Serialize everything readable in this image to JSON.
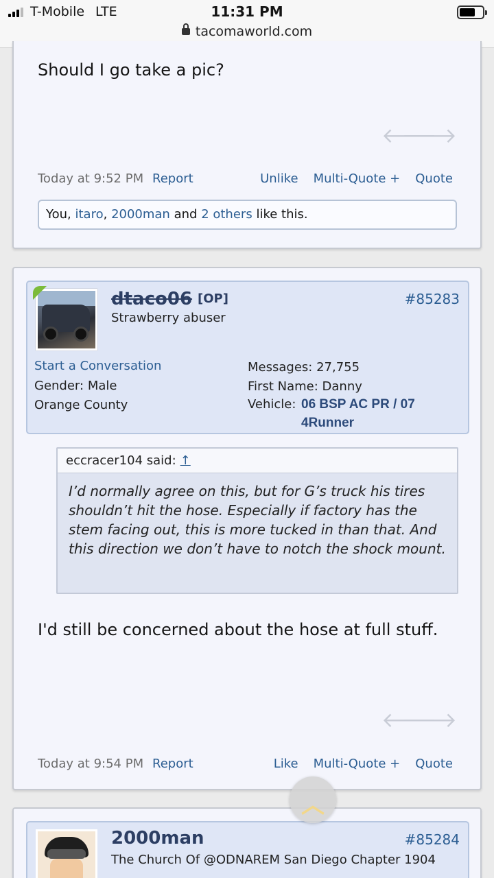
{
  "status_bar": {
    "carrier": "T-Mobile",
    "network": "LTE",
    "time": "11:31 PM",
    "url": "tacomaworld.com"
  },
  "post1": {
    "message": "Should I go take a pic?",
    "timestamp": "Today at 9:52 PM",
    "report": "Report",
    "like_action": "Unlike",
    "multi_quote": "Multi-Quote +",
    "quote": "Quote",
    "likes": {
      "you": "You,",
      "user1": "itaro",
      "sep": ",",
      "user2": "2000man",
      "and": "and",
      "others": "2 others",
      "tail": "like this."
    }
  },
  "post2": {
    "username": "dtaco06",
    "op_tag": "[OP]",
    "user_title": "Strawberry abuser",
    "post_number": "#85283",
    "start_conversation": "Start a Conversation",
    "gender_label": "Gender:",
    "gender_value": "Male",
    "location": "Orange County",
    "messages_label": "Messages:",
    "messages_value": "27,755",
    "first_name_label": "First Name:",
    "first_name_value": "Danny",
    "vehicle_label": "Vehicle:",
    "vehicle_line1": "06 BSP AC PR / 07",
    "vehicle_line2": "4Runner",
    "quote_author": "eccracer104 said:",
    "quote_up": "↑",
    "quote_text": "I’d normally agree on this, but for G’s truck his tires shouldn’t hit the hose. Especially if factory has the stem facing out, this is more tucked in than that. And this direction we don’t have to notch the shock mount.",
    "message": "I'd still be concerned about the hose at full stuff.",
    "timestamp": "Today at 9:54 PM",
    "report": "Report",
    "like_action": "Like",
    "multi_quote": "Multi-Quote +",
    "quote": "Quote"
  },
  "post3": {
    "username": "2000man",
    "user_title": "The Church Of @ODNAREM San Diego Chapter 1904",
    "post_number": "#85284"
  },
  "colors": {
    "link": "#2b5d92",
    "post_bg": "#f4f5fc",
    "userbox_bg": "#dfe6f6",
    "online": "#7cbb3a"
  },
  "icons": {
    "prev": "arrow-left-icon",
    "next": "arrow-right-icon",
    "scroll_top": "chevron-up-icon"
  }
}
